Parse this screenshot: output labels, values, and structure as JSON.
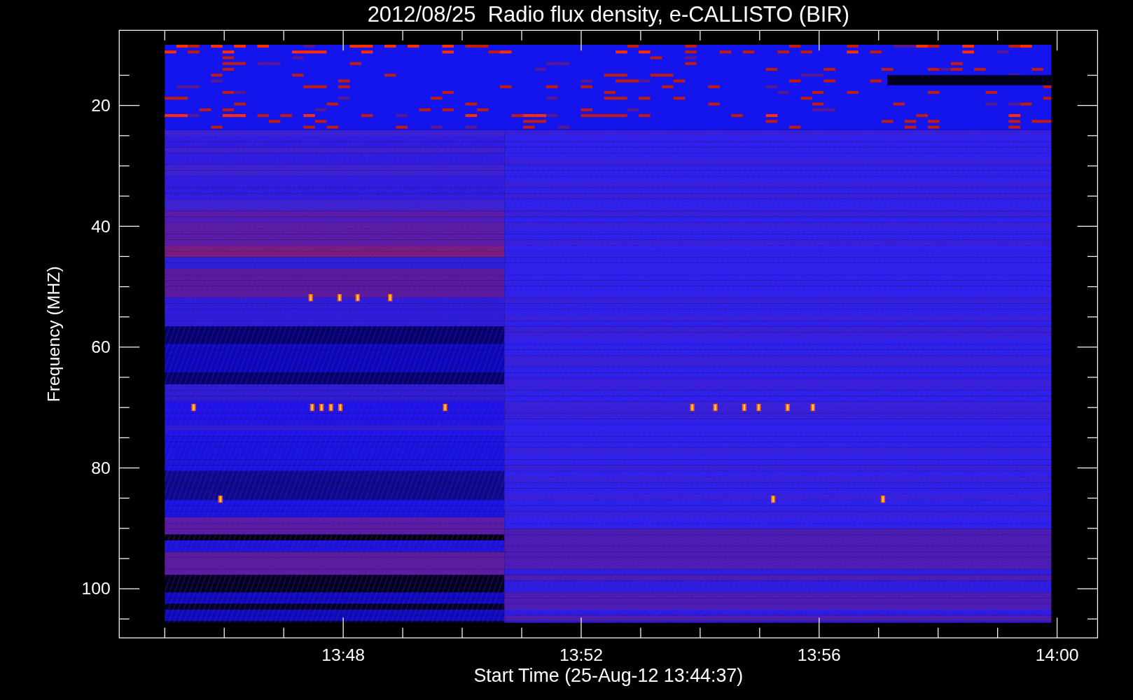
{
  "title": "2012/08/25  Radio flux density, e-CALLISTO (BIR)",
  "y_axis": {
    "label": "Frequency (MHZ)",
    "ticks": [
      "20",
      "40",
      "60",
      "80",
      "100"
    ]
  },
  "x_axis": {
    "label": "Start Time (25-Aug-12 13:44:37)",
    "ticks": [
      "13:48",
      "13:52",
      "13:56",
      "14:00"
    ]
  }
}
